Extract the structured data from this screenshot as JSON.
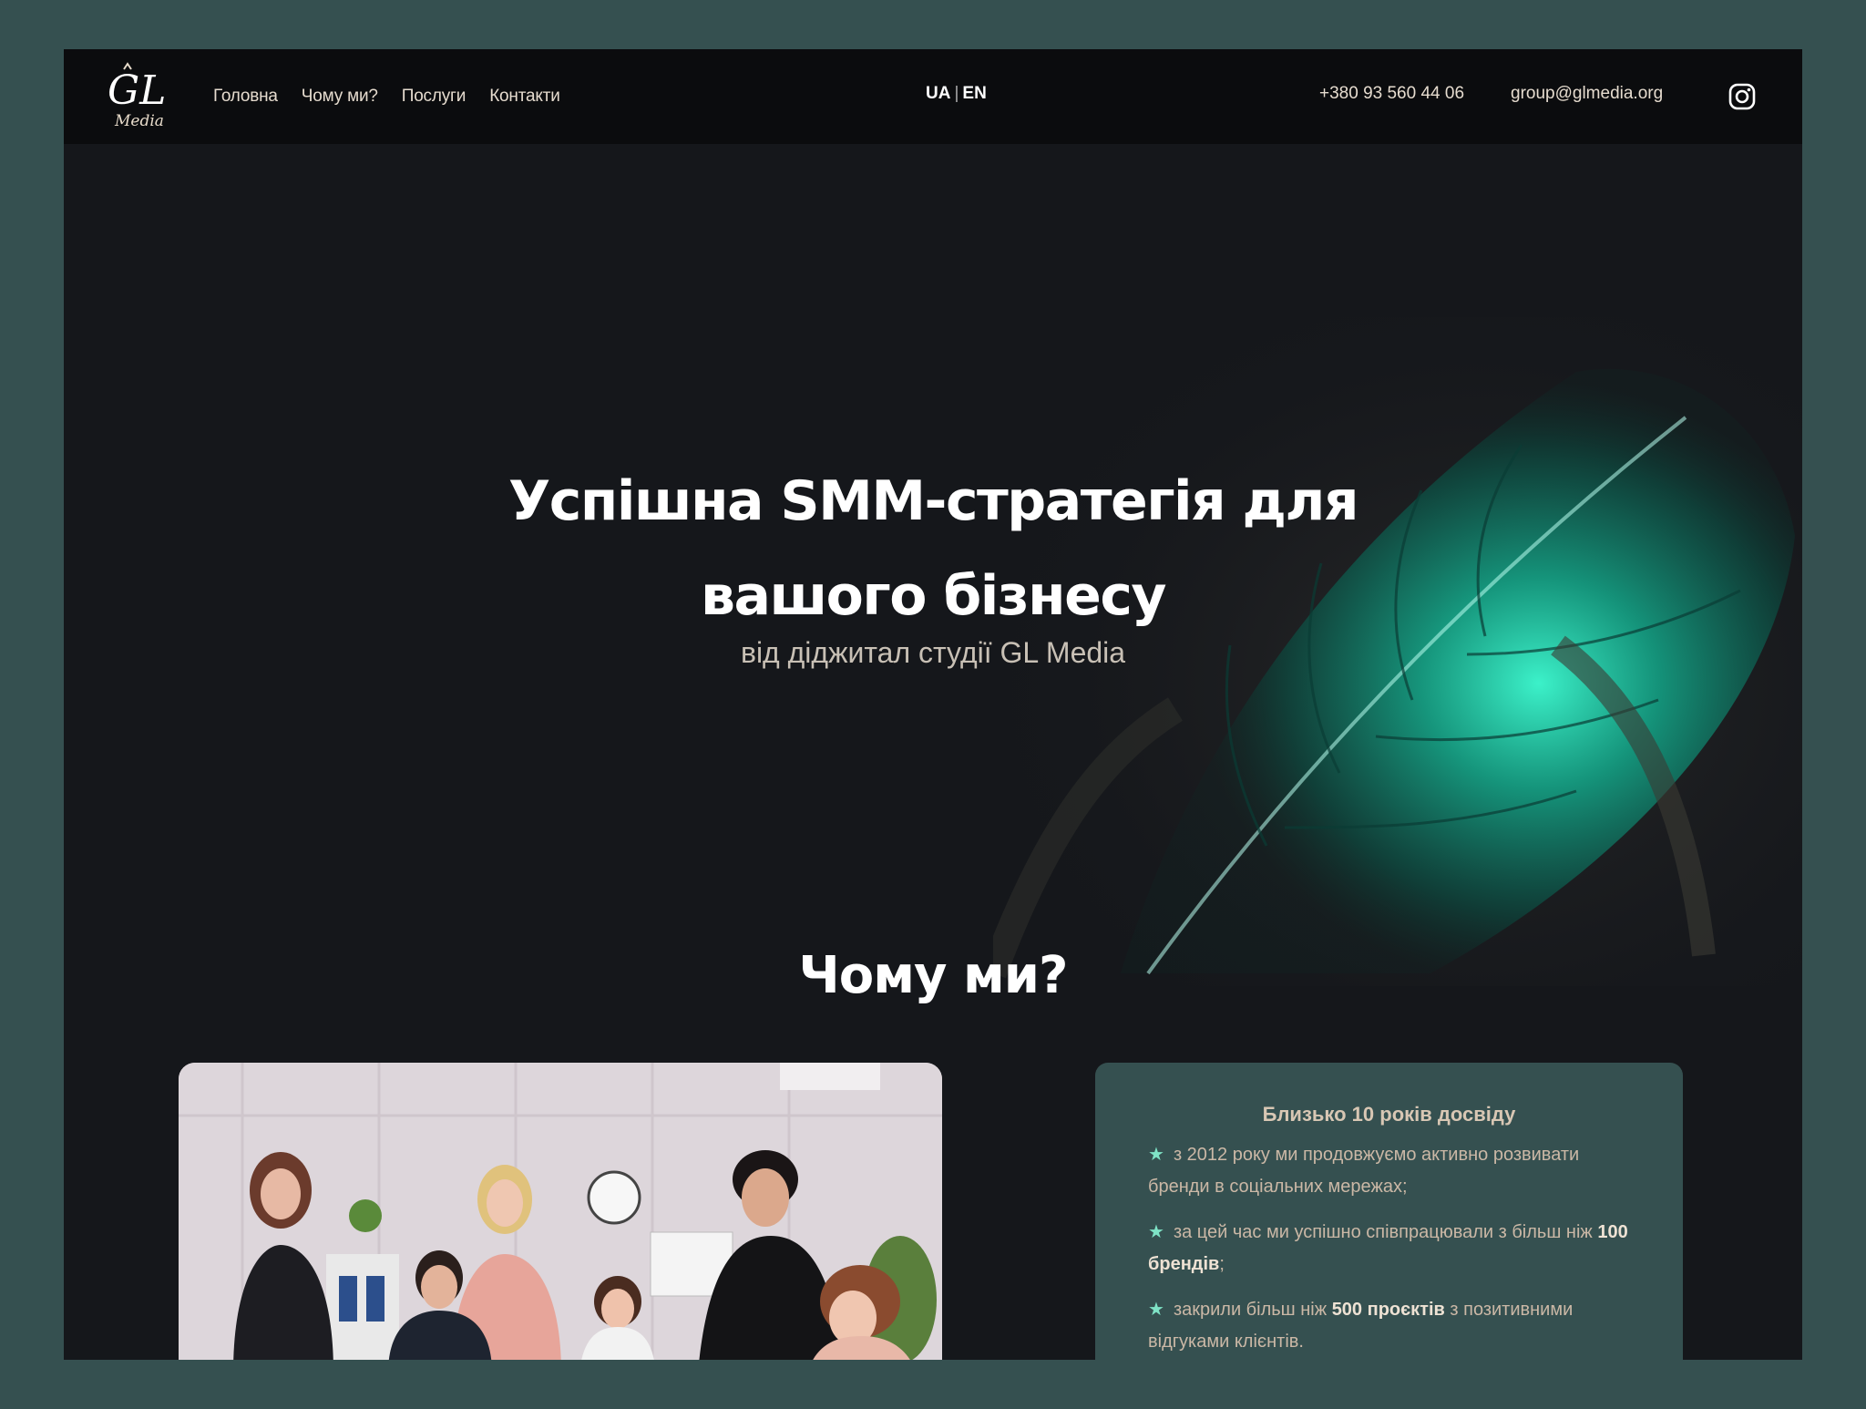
{
  "header": {
    "logo_text": "GL",
    "logo_sub": "Media",
    "nav": [
      "Головна",
      "Чому ми?",
      "Послуги",
      "Контакти"
    ],
    "lang_ua": "UA",
    "lang_sep": "|",
    "lang_en": "EN",
    "phone": "+380 93 560 44 06",
    "email": "group@glmedia.org",
    "social_icon": "instagram-icon"
  },
  "hero": {
    "title_line1": "Успішна SMM-стратегія для",
    "title_line2": "вашого бізнесу",
    "subtitle": "від діджитал студії GL Media",
    "accent": "#1fd6b0"
  },
  "why": {
    "title": "Чому ми?",
    "card": {
      "title": "Близько 10 років досвіду",
      "items": [
        {
          "text": "з 2012 року ми продовжуємо активно розвивати бренди в соціальних мережах;"
        },
        {
          "pre": "за цей час ми успішно співпрацювали з більш ніж ",
          "bold": "100 брендів",
          "post": ";"
        },
        {
          "pre": "закрили більш ніж ",
          "bold": "500 проєктів",
          "post": " з позитивними відгуками клієнтів."
        }
      ]
    }
  }
}
